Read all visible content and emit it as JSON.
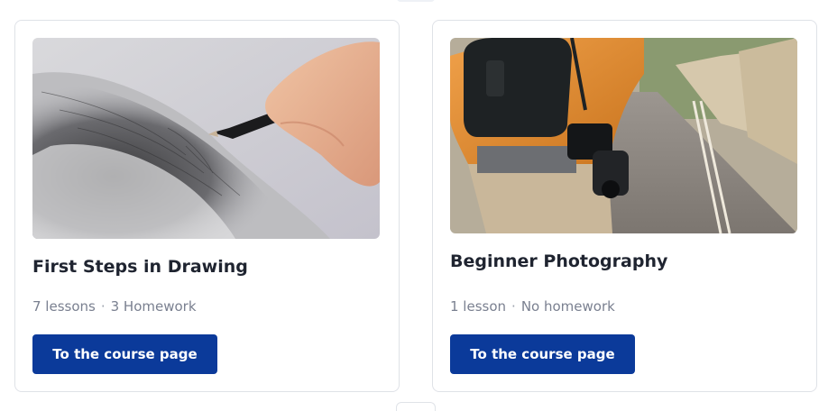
{
  "courses": [
    {
      "title": "First Steps in Drawing",
      "lessons": "7 lessons",
      "homework": "3 Homework",
      "button_label": "To the course page",
      "image": "pencil-sketch-photo"
    },
    {
      "title": "Beginner Photography",
      "lessons": "1 lesson",
      "homework": "No homework",
      "button_label": "To the course page",
      "image": "photographer-street-photo"
    }
  ],
  "separator": "·",
  "colors": {
    "button": "#0b3a9a",
    "meta_text": "#7a8090",
    "card_border": "#dfe2e7"
  }
}
